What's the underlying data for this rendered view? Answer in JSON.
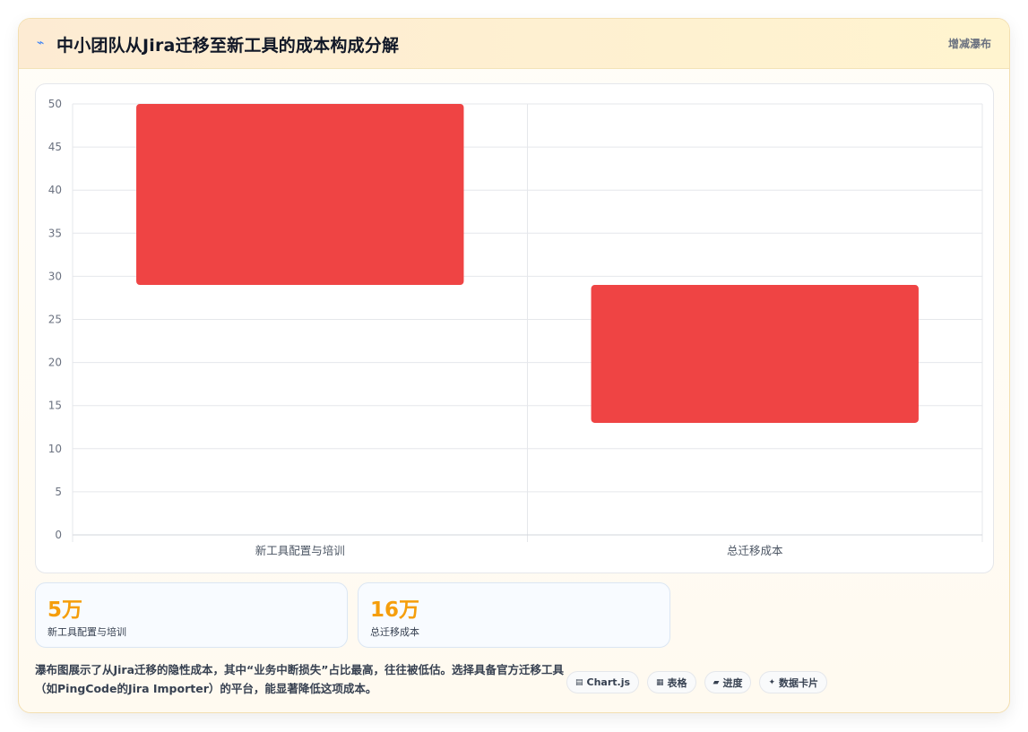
{
  "header": {
    "icon": "trend-icon",
    "title": "中小团队从Jira迁移至新工具的成本构成分解",
    "badge": "增减瀑布"
  },
  "chart_data": {
    "type": "bar",
    "subtype": "waterfall",
    "categories": [
      "新工具配置与培训",
      "总迁移成本"
    ],
    "ranges": [
      [
        29,
        50
      ],
      [
        13,
        29
      ]
    ],
    "ylim": [
      0,
      50
    ],
    "yticks": [
      0,
      5,
      10,
      15,
      20,
      25,
      30,
      35,
      40,
      45,
      50
    ],
    "title": "",
    "xlabel": "",
    "ylabel": "",
    "grid": true,
    "bar_color": "#ef4444"
  },
  "stats": [
    {
      "value": "5万",
      "label": "新工具配置与培训"
    },
    {
      "value": "16万",
      "label": "总迁移成本"
    }
  ],
  "description": "瀑布图展示了从Jira迁移的隐性成本，其中“业务中断损失”占比最高，往往被低估。选择具备官方迁移工具（如PingCode的Jira Importer）的平台，能显著降低这项成本。",
  "chips": [
    {
      "icon": "chart-icon",
      "glyph": "▤",
      "label": "Chart.js"
    },
    {
      "icon": "table-icon",
      "glyph": "▦",
      "label": "表格"
    },
    {
      "icon": "progress-icon",
      "glyph": "▰",
      "label": "进度"
    },
    {
      "icon": "sparkle-icon",
      "glyph": "✦",
      "label": "数据卡片"
    }
  ]
}
